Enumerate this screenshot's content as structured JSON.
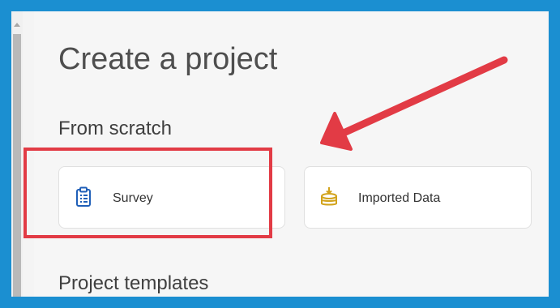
{
  "main": {
    "title": "Create a project",
    "from_scratch": {
      "heading": "From scratch",
      "cards": [
        {
          "label": "Survey",
          "icon": "clipboard-icon",
          "icon_color": "#1f5fb8"
        },
        {
          "label": "Imported Data",
          "icon": "database-import-icon",
          "icon_color": "#d2a31b"
        }
      ]
    },
    "templates_heading": "Project templates"
  },
  "annotations": {
    "highlight_color": "#e23b45",
    "arrow_color": "#e23b45"
  },
  "colors": {
    "frame_border": "#1b8fd1",
    "page_background": "#f6f6f6"
  }
}
